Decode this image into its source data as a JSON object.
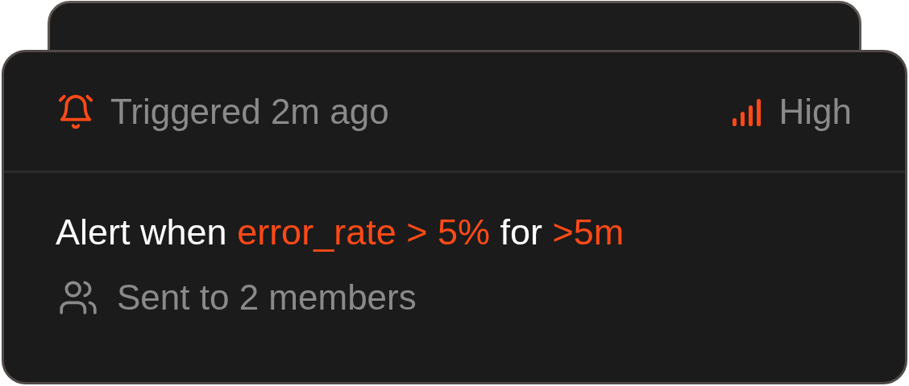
{
  "alert": {
    "status": "Triggered 2m ago",
    "severity": "High",
    "condition": [
      {
        "text": "Alert when ",
        "highlight": false
      },
      {
        "text": "error_rate > 5%",
        "highlight": true
      },
      {
        "text": " for ",
        "highlight": false
      },
      {
        "text": ">5m",
        "highlight": true
      }
    ],
    "recipients": "Sent to 2 members"
  }
}
